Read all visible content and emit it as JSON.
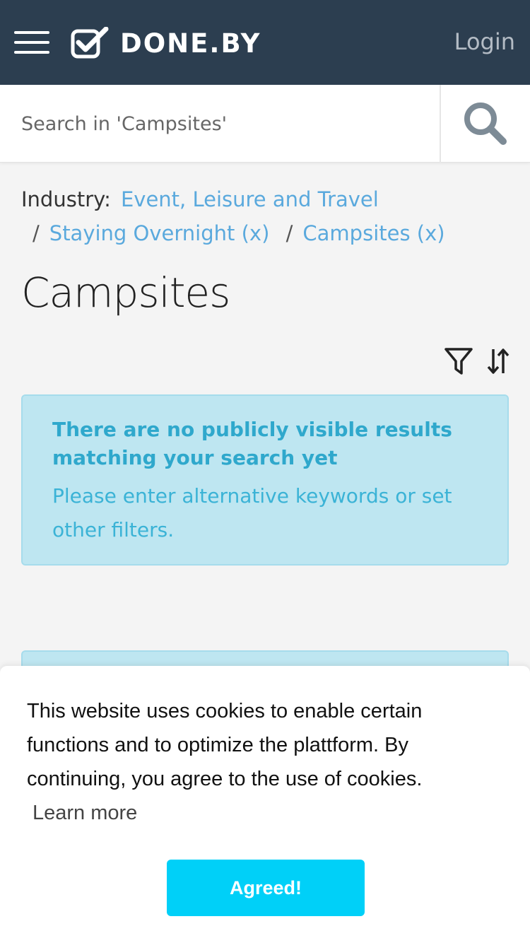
{
  "header": {
    "brand": "DONE.BY",
    "login_label": "Login"
  },
  "search": {
    "placeholder": "Search in 'Campsites'"
  },
  "breadcrumb": {
    "label": "Industry:",
    "items": [
      "Event, Leisure and Travel",
      "Staying Overnight (x)",
      "Campsites (x)"
    ],
    "separator": "/"
  },
  "page": {
    "title": "Campsites"
  },
  "tools": {
    "icons": [
      "filter-icon",
      "sort-icon"
    ]
  },
  "alert": {
    "title": "There are no publicly visible results matching your search yet",
    "text": "Please enter alternative keywords or set other filters."
  },
  "cookie": {
    "text": "This website uses cookies to enable certain functions and to optimize the plattform. By continuing, you agree to the use of cookies.",
    "learn_more": "Learn more",
    "button": "Agreed!"
  },
  "colors": {
    "header_bg": "#2c3e50",
    "link": "#5aa9dd",
    "alert_bg": "#bee6f1",
    "alert_text": "#2fa8cc",
    "cookie_button": "#00d0f8"
  }
}
